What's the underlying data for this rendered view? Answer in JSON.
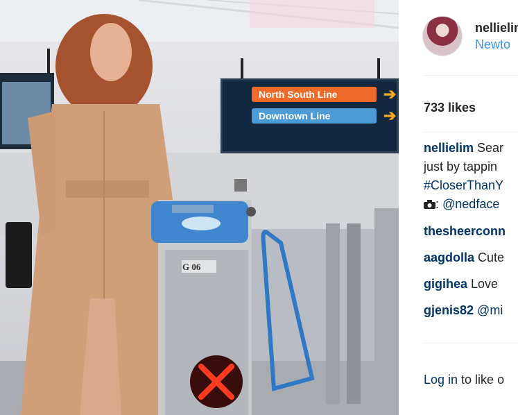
{
  "sign": {
    "line1": "North South Line",
    "line2": "Downtown Line",
    "arrow": "➔"
  },
  "gate": {
    "label": "G 06",
    "status_icon": "x-icon"
  },
  "post": {
    "username": "nellielim",
    "location": "Newto",
    "likes": "733 likes"
  },
  "comments": [
    {
      "user": "nellielim",
      "text": " Sear",
      "hashtag": "",
      "cont": "just by tappin"
    },
    {
      "hashtag": "#CloserThanY"
    },
    {
      "icon": "camera-icon",
      "mention": "@nedface"
    }
  ],
  "other_comments": [
    {
      "user": "thesheerconn",
      "text": ""
    },
    {
      "user": "aagdolla",
      "text": " Cute"
    },
    {
      "user": "gigihea",
      "text": " Love"
    },
    {
      "user": "gjenis82",
      "text": " @mi"
    }
  ],
  "login": {
    "link": "Log in",
    "text": " to like o"
  },
  "colors": {
    "link": "#003569",
    "location": "#3897f0",
    "sign_orange": "#f06a2a",
    "sign_blue": "#4a9bd6"
  }
}
